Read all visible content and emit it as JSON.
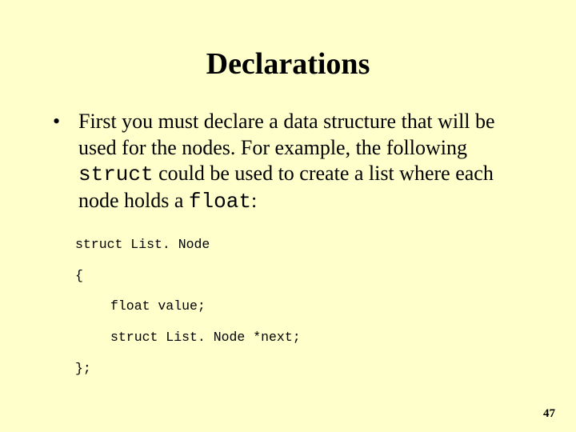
{
  "title": "Declarations",
  "bullets": [
    {
      "pre": "First you must declare a data structure that will be used for the nodes. For example, the following ",
      "code1": "struct",
      "mid": " could be used to create a list where each node holds a ",
      "code2": "float",
      "post": ":"
    }
  ],
  "code": {
    "l1": "struct List. Node",
    "l2": "{",
    "l3": "float value;",
    "l4": "struct List. Node *next;",
    "l5": "};"
  },
  "page": "47"
}
